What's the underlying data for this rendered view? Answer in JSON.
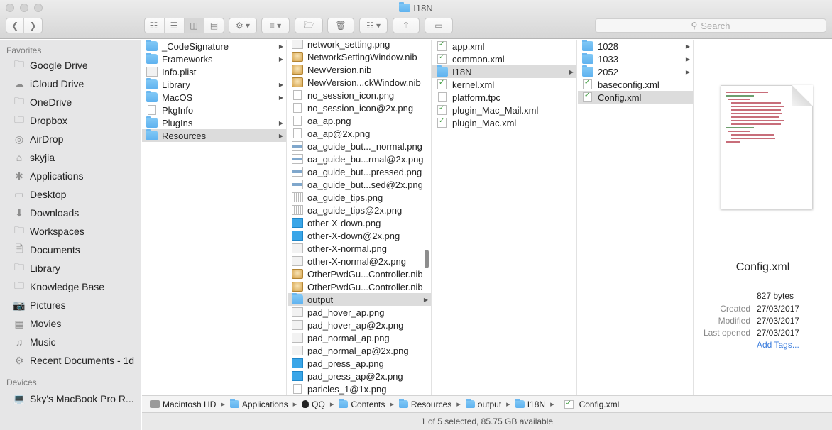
{
  "window": {
    "title": "I18N"
  },
  "search": {
    "placeholder": "Search"
  },
  "sidebar": {
    "favorites_header": "Favorites",
    "favorites": [
      {
        "label": "Google Drive",
        "icon": "folder-icon"
      },
      {
        "label": "iCloud Drive",
        "icon": "cloud-icon"
      },
      {
        "label": "OneDrive",
        "icon": "folder-icon"
      },
      {
        "label": "Dropbox",
        "icon": "folder-icon"
      },
      {
        "label": "AirDrop",
        "icon": "airdrop-icon"
      },
      {
        "label": "skyjia",
        "icon": "home-icon"
      },
      {
        "label": "Applications",
        "icon": "applications-icon"
      },
      {
        "label": "Desktop",
        "icon": "desktop-icon"
      },
      {
        "label": "Downloads",
        "icon": "download-icon"
      },
      {
        "label": "Workspaces",
        "icon": "folder-icon"
      },
      {
        "label": "Documents",
        "icon": "documents-icon"
      },
      {
        "label": "Library",
        "icon": "folder-icon"
      },
      {
        "label": "Knowledge Base",
        "icon": "folder-icon"
      },
      {
        "label": "Pictures",
        "icon": "camera-icon"
      },
      {
        "label": "Movies",
        "icon": "film-icon"
      },
      {
        "label": "Music",
        "icon": "music-icon"
      },
      {
        "label": "Recent Documents - 1d",
        "icon": "gear-icon"
      }
    ],
    "devices_header": "Devices",
    "devices": [
      {
        "label": "Sky's MacBook Pro R...",
        "icon": "laptop-icon"
      }
    ]
  },
  "columns": {
    "col1": [
      {
        "name": "_CodeSignature",
        "kind": "folder",
        "arrow": true
      },
      {
        "name": "Frameworks",
        "kind": "folder",
        "arrow": true
      },
      {
        "name": "Info.plist",
        "kind": "png"
      },
      {
        "name": "Library",
        "kind": "folder",
        "arrow": true
      },
      {
        "name": "MacOS",
        "kind": "folder",
        "arrow": true
      },
      {
        "name": "PkgInfo",
        "kind": "doc"
      },
      {
        "name": "PlugIns",
        "kind": "folder",
        "arrow": true
      },
      {
        "name": "Resources",
        "kind": "folder",
        "arrow": true,
        "selected": true
      }
    ],
    "col2": [
      {
        "name": "network_setting.png",
        "kind": "png"
      },
      {
        "name": "NetworkSettingWindow.nib",
        "kind": "nib"
      },
      {
        "name": "NewVersion.nib",
        "kind": "nib"
      },
      {
        "name": "NewVersion...ckWindow.nib",
        "kind": "nib"
      },
      {
        "name": "no_session_icon.png",
        "kind": "doc"
      },
      {
        "name": "no_session_icon@2x.png",
        "kind": "doc"
      },
      {
        "name": "oa_ap.png",
        "kind": "doc"
      },
      {
        "name": "oa_ap@2x.png",
        "kind": "doc"
      },
      {
        "name": "oa_guide_but..._normal.png",
        "kind": "pngbar"
      },
      {
        "name": "oa_guide_bu...rmal@2x.png",
        "kind": "pngbar"
      },
      {
        "name": "oa_guide_but...pressed.png",
        "kind": "pngbar"
      },
      {
        "name": "oa_guide_but...sed@2x.png",
        "kind": "pngbar"
      },
      {
        "name": "oa_guide_tips.png",
        "kind": "pngdots"
      },
      {
        "name": "oa_guide_tips@2x.png",
        "kind": "pngdots"
      },
      {
        "name": "other-X-down.png",
        "kind": "pngblue"
      },
      {
        "name": "other-X-down@2x.png",
        "kind": "pngblue"
      },
      {
        "name": "other-X-normal.png",
        "kind": "png"
      },
      {
        "name": "other-X-normal@2x.png",
        "kind": "png"
      },
      {
        "name": "OtherPwdGu...Controller.nib",
        "kind": "nib"
      },
      {
        "name": "OtherPwdGu...Controller.nib",
        "kind": "nib"
      },
      {
        "name": "output",
        "kind": "folder",
        "arrow": true,
        "selected": true
      },
      {
        "name": "pad_hover_ap.png",
        "kind": "png"
      },
      {
        "name": "pad_hover_ap@2x.png",
        "kind": "png"
      },
      {
        "name": "pad_normal_ap.png",
        "kind": "png"
      },
      {
        "name": "pad_normal_ap@2x.png",
        "kind": "png"
      },
      {
        "name": "pad_press_ap.png",
        "kind": "pngblue"
      },
      {
        "name": "pad_press_ap@2x.png",
        "kind": "pngblue"
      },
      {
        "name": "paricles_1@1x.png",
        "kind": "doc"
      }
    ],
    "col3": [
      {
        "name": "app.xml",
        "kind": "xml"
      },
      {
        "name": "common.xml",
        "kind": "xml"
      },
      {
        "name": "I18N",
        "kind": "folder",
        "arrow": true,
        "selected": true
      },
      {
        "name": "kernel.xml",
        "kind": "xml"
      },
      {
        "name": "platform.tpc",
        "kind": "doc"
      },
      {
        "name": "plugin_Mac_Mail.xml",
        "kind": "xml"
      },
      {
        "name": "plugin_Mac.xml",
        "kind": "xml"
      }
    ],
    "col4": [
      {
        "name": "1028",
        "kind": "folder",
        "arrow": true
      },
      {
        "name": "1033",
        "kind": "folder",
        "arrow": true
      },
      {
        "name": "2052",
        "kind": "folder",
        "arrow": true
      },
      {
        "name": "baseconfig.xml",
        "kind": "xml"
      },
      {
        "name": "Config.xml",
        "kind": "xml",
        "selected": true
      }
    ]
  },
  "preview": {
    "name": "Config.xml",
    "size": "827 bytes",
    "created_label": "Created",
    "created": "27/03/2017",
    "modified_label": "Modified",
    "modified": "27/03/2017",
    "last_opened_label": "Last opened",
    "last_opened": "27/03/2017",
    "add_tags": "Add Tags..."
  },
  "pathbar": [
    {
      "label": "Macintosh HD",
      "icon": "disk"
    },
    {
      "label": "Applications",
      "icon": "folder"
    },
    {
      "label": "QQ",
      "icon": "penguin"
    },
    {
      "label": "Contents",
      "icon": "folder"
    },
    {
      "label": "Resources",
      "icon": "folder"
    },
    {
      "label": "output",
      "icon": "folder"
    },
    {
      "label": "I18N",
      "icon": "folder"
    },
    {
      "label": "Config.xml",
      "icon": "xml"
    }
  ],
  "status": "1 of 5 selected, 85.75 GB available"
}
